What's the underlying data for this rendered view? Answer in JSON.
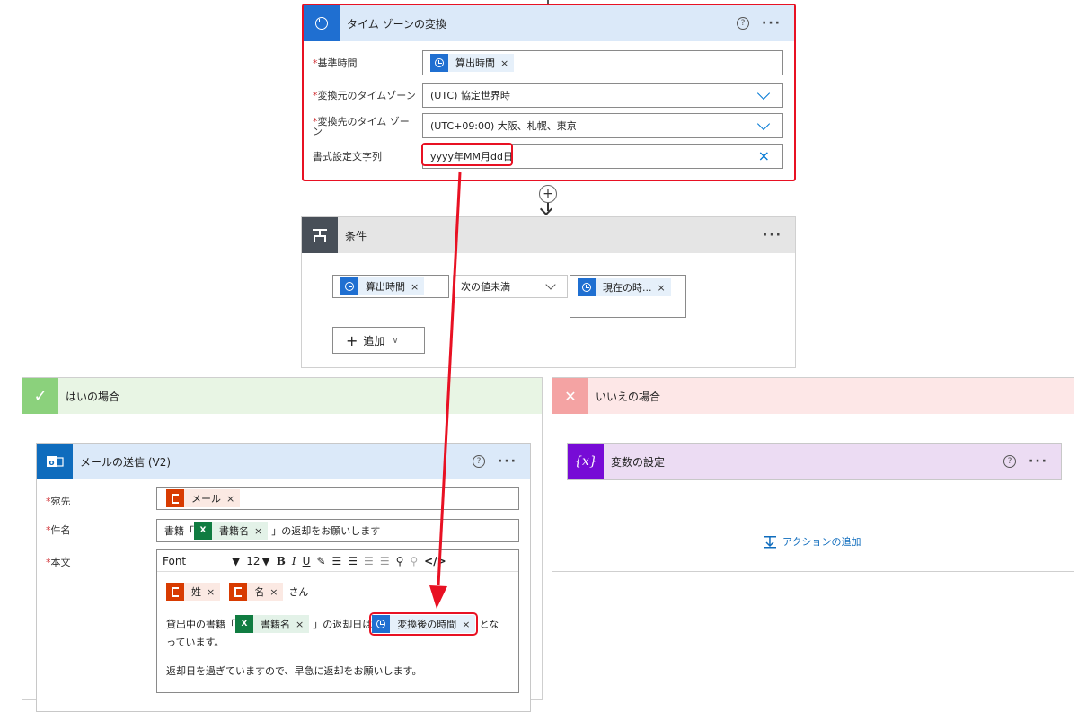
{
  "timezone_card": {
    "title": "タイム ゾーンの変換",
    "help": "?",
    "more": "···",
    "fields": {
      "base_time": {
        "label": "基準時間",
        "required": "*",
        "token": "算出時間",
        "remove": "×"
      },
      "source_tz": {
        "label": "変換元のタイムゾーン",
        "required": "*",
        "value": "(UTC) 協定世界時"
      },
      "target_tz": {
        "label_line1": "変換先のタイム ゾー",
        "label_line2": "ン",
        "required": "*",
        "value": "(UTC+09:00) 大阪、札幌、東京"
      },
      "format": {
        "label": "書式設定文字列",
        "value": "yyyy年MM月dd日",
        "clear": "×"
      }
    }
  },
  "add_step": "+",
  "condition_card": {
    "title": "条件",
    "more": "···",
    "left_token": "算出時間",
    "operator": "次の値未満",
    "right_token": "現在の時...",
    "remove": "×",
    "add_label": "追加",
    "add_plus": "+",
    "add_chevron": "∨"
  },
  "yes_branch": {
    "title": "はいの場合",
    "check": "✓",
    "mail_card": {
      "title": "メールの送信 (V2)",
      "help": "?",
      "more": "···",
      "to": {
        "label": "宛先",
        "required": "*",
        "token": "メール"
      },
      "subject": {
        "label": "件名",
        "required": "*",
        "prefix": "書籍「",
        "token": "書籍名",
        "suffix": "」の返却をお願いします"
      },
      "body": {
        "label": "本文",
        "required": "*",
        "font": "Font",
        "font_size": "12",
        "tok_sei": "姓",
        "tok_mei": "名",
        "san": "さん",
        "line2_prefix": "貸出中の書籍「",
        "line2_token": "書籍名",
        "line2_mid": "」の返却日は",
        "line2_token2": "変換後の時間",
        "line2_suffix": "とな",
        "line3": "っています。",
        "line4": "返却日を過ぎていますので、早急に返却をお願いします。"
      },
      "remove": "×"
    }
  },
  "no_branch": {
    "title": "いいえの場合",
    "cross": "✕",
    "var_card": {
      "title": "変数の設定",
      "icon_text": "{x}",
      "help": "?",
      "more": "···"
    },
    "add_action": "アクションの追加"
  },
  "colors": {
    "red_highlight": "#e81123",
    "flow_blue": "#1f6fd1",
    "yes_green": "#8bd17c",
    "no_red": "#f4a3a3",
    "var_purple": "#770bd6"
  }
}
